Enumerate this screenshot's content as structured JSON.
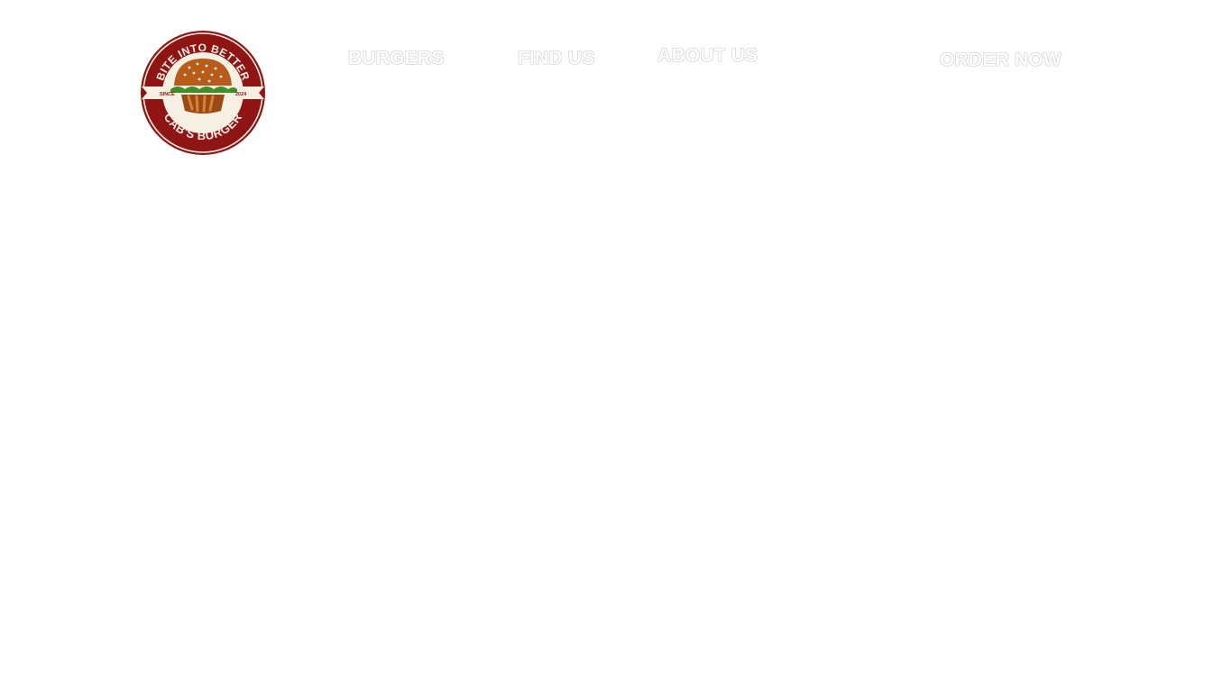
{
  "brand": {
    "name": "CAB'S BURGER",
    "tagline": "BITE INTO BETTER",
    "since_label": "SINCE",
    "since_year": "2024",
    "colors": {
      "badge_red": "#8f1414",
      "bun": "#b85c1c",
      "lettuce": "#3e8f2a",
      "cream": "#f6efe3"
    }
  },
  "nav": {
    "burgers": "BURGERS",
    "find_us": "FIND US",
    "about_us": "ABOUT US",
    "order_now": "ORDER NOW"
  }
}
